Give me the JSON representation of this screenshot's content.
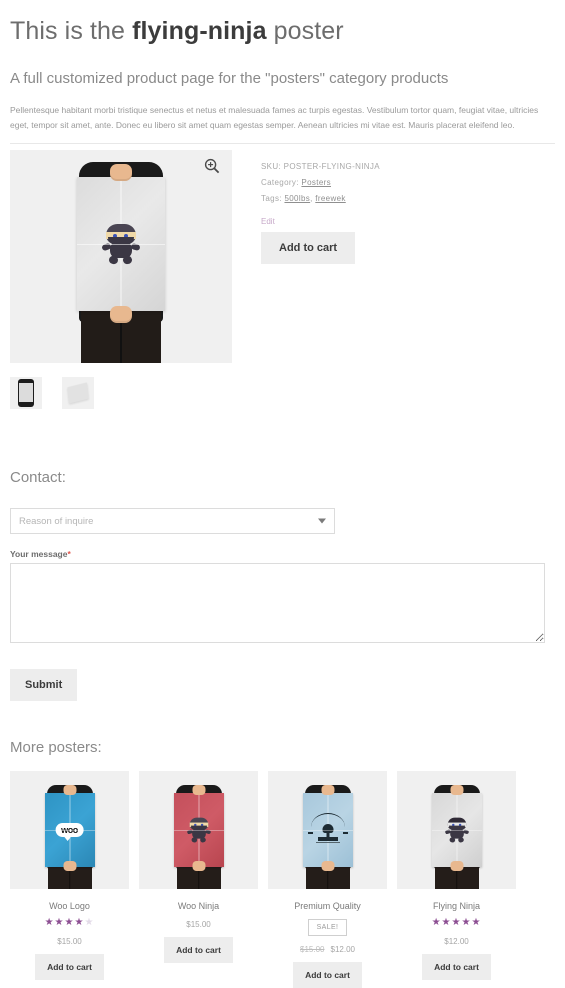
{
  "header": {
    "title_pre": "This is the ",
    "title_strong": "flying-ninja",
    "title_post": " poster",
    "subtitle": "A full customized product page for the \"posters\" category products",
    "description": "Pellentesque habitant morbi tristique senectus et netus et malesuada fames ac turpis egestas. Vestibulum tortor quam, feugiat vitae, ultricies eget, tempor sit amet, ante. Donec eu libero sit amet quam egestas semper. Aenean ultricies mi vitae est. Mauris placerat eleifend leo."
  },
  "product": {
    "zoom_icon": "magnifier-plus-icon",
    "sku_label": "SKU:",
    "sku_value": "POSTER-FLYING-NINJA",
    "category_label": "Category:",
    "category_value": "Posters",
    "tags_label": "Tags:",
    "tags": [
      "500lbs",
      "freewek"
    ],
    "tags_separator": ", ",
    "edit_label": "Edit",
    "add_to_cart_label": "Add to cart",
    "thumbnails": [
      "poster-held-thumbnail",
      "poster-flat-thumbnail"
    ]
  },
  "contact": {
    "title": "Contact:",
    "select_placeholder": "Reason of inquire",
    "select_options": [
      "Reason of inquire"
    ],
    "message_label": "Your message",
    "message_required_mark": "*",
    "message_value": "",
    "submit_label": "Submit"
  },
  "more": {
    "title": "More posters:",
    "products": [
      {
        "name": "Woo Logo",
        "poster_style": "sheet-blue",
        "art": "woo-logo",
        "rating": 4,
        "rating_max": 5,
        "price": "$15.00",
        "old_price": "",
        "sale_badge": "",
        "add_to_cart_label": "Add to cart"
      },
      {
        "name": "Woo Ninja",
        "poster_style": "sheet-red",
        "art": "ninja-red",
        "rating": 0,
        "rating_max": 5,
        "price": "$15.00",
        "old_price": "",
        "sale_badge": "",
        "add_to_cart_label": "Add to cart"
      },
      {
        "name": "Premium Quality",
        "poster_style": "sheet-lblue",
        "art": "premium-mark",
        "rating": 0,
        "rating_max": 5,
        "price": "$12.00",
        "old_price": "$15.00",
        "sale_badge": "SALE!",
        "add_to_cart_label": "Add to cart"
      },
      {
        "name": "Flying Ninja",
        "poster_style": "sheet-gray",
        "art": "ninja-gray",
        "rating": 5,
        "rating_max": 5,
        "price": "$12.00",
        "old_price": "",
        "sale_badge": "",
        "add_to_cart_label": "Add to cart"
      }
    ]
  },
  "colors": {
    "star_filled": "#8d4f93",
    "star_empty": "#e3dbe8",
    "required": "#e2544b",
    "button_bg": "#ededed",
    "text_muted": "#a8a8a8"
  }
}
